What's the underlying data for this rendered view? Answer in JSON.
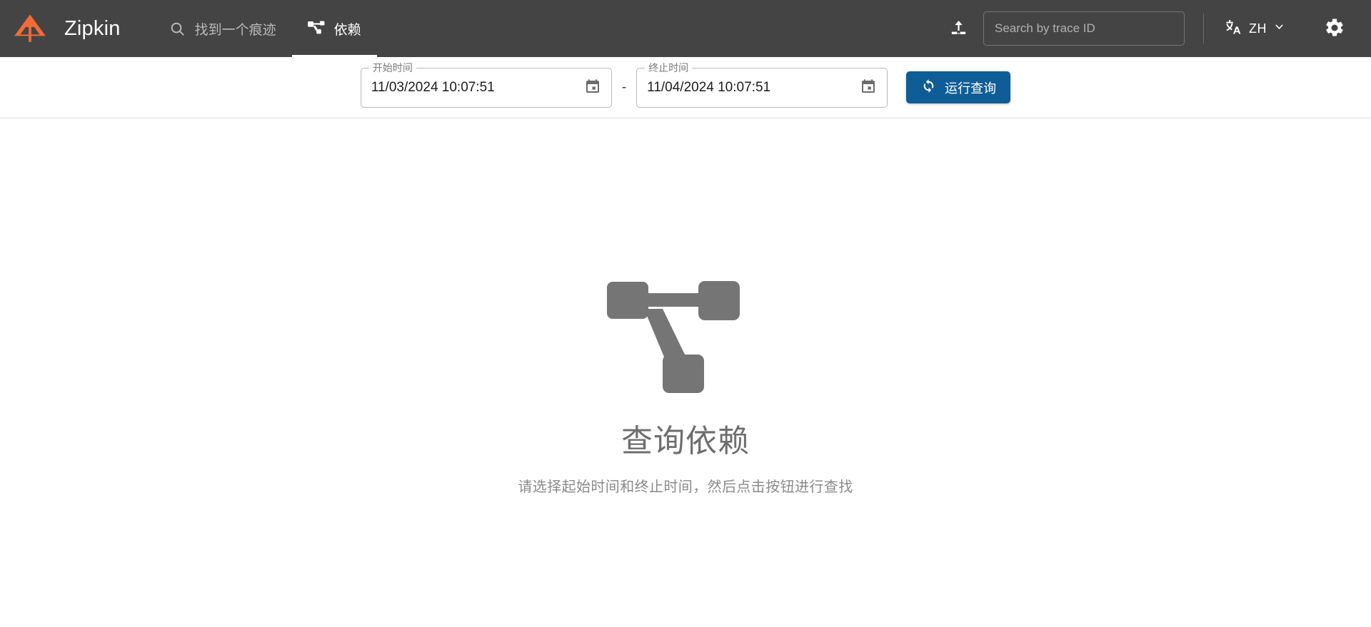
{
  "navbar": {
    "logo_icon": "zipkin-logo-icon",
    "logo_color": "#f26b38",
    "brand": "Zipkin",
    "background": "#444444",
    "tabs": [
      {
        "label": "找到一个痕迹",
        "icon": "search-icon",
        "active": false
      },
      {
        "label": "依赖",
        "icon": "dependency-graph-icon",
        "active": true
      }
    ],
    "upload_icon": "upload-icon",
    "trace_search": {
      "placeholder": "Search by trace ID",
      "value": ""
    },
    "language": {
      "icon": "translate-icon",
      "code": "ZH",
      "chevron": "chevron-down-icon"
    },
    "settings_icon": "gear-icon"
  },
  "query_bar": {
    "start_time": {
      "legend": "开始时间",
      "value": "11/03/2024 10:07:51",
      "calendar_icon": "calendar-icon"
    },
    "range_separator": "-",
    "end_time": {
      "legend": "终止时间",
      "value": "11/04/2024 10:07:51",
      "calendar_icon": "calendar-icon"
    },
    "run_query": {
      "label": "运行查询",
      "icon": "refresh-icon",
      "color": "#0f5d96"
    }
  },
  "empty_state": {
    "icon": "dependency-graph-icon",
    "icon_color": "#757575",
    "title": "查询依赖",
    "subtitle": "请选择起始时间和终止时间，然后点击按钮进行查找"
  }
}
